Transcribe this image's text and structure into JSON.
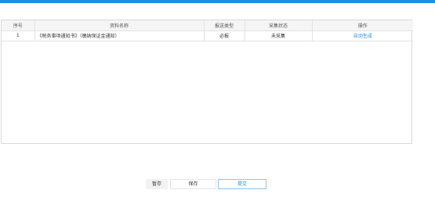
{
  "colors": {
    "accent": "#1e8fe1",
    "header_bg": "#f5f5f5",
    "border": "#d9d9d9"
  },
  "table": {
    "headers": [
      "序号",
      "资料名称",
      "报送类型",
      "采集状态",
      "操作"
    ],
    "rows": [
      {
        "index": "1",
        "name": "《税务事项通知书》（缴纳保证金通知）",
        "type": "必报",
        "status": "未采集",
        "action": "自动生成"
      }
    ]
  },
  "buttons": {
    "temp_save": "暂存",
    "save": "保存",
    "submit": "提交"
  }
}
